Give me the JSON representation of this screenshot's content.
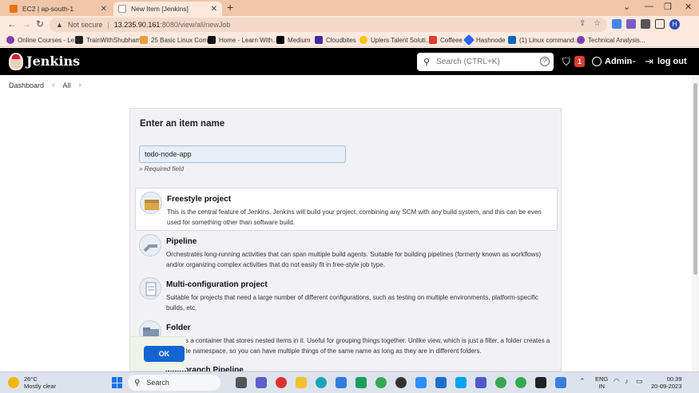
{
  "browser": {
    "tabs": [
      {
        "title": "EC2 | ap-south-1",
        "active": false,
        "icon": "aws-icon"
      },
      {
        "title": "New Item [Jenkins]",
        "active": true,
        "icon": "page-icon"
      }
    ],
    "address": {
      "security": "Not secure",
      "host": "13.235.90.161",
      "path": ":8080/view/all/newJob"
    },
    "profile_initial": "H",
    "bookmarks": [
      "Online Courses - Le...",
      "TrainWithShubham",
      "25 Basic Linux Com...",
      "Home - Learn With...",
      "Medium",
      "Cloudbites",
      "Uplers Talent Soluti...",
      "Coffeee",
      "Hashnode",
      "(1) Linux command...",
      "Technical Analysis..."
    ]
  },
  "header": {
    "app_name": "Jenkins",
    "search_placeholder": "Search (CTRL+K)",
    "notification_count": "1",
    "user": "Admin",
    "logout": "log out"
  },
  "breadcrumb": [
    "Dashboard",
    "All"
  ],
  "form": {
    "title": "Enter an item name",
    "item_name": "todo-node-app",
    "required_note": "» Required field",
    "ok_label": "OK"
  },
  "item_types": [
    {
      "name": "Freestyle project",
      "desc": "This is the central feature of Jenkins. Jenkins will build your project, combining any SCM with any build system, and this can be even used for something other than software build.",
      "selected": true,
      "icon": "freestyle-project-icon"
    },
    {
      "name": "Pipeline",
      "desc": "Orchestrates long-running activities that can span multiple build agents. Suitable for building pipelines (formerly known as workflows) and/or organizing complex activities that do not easily fit in free-style job type.",
      "selected": false,
      "icon": "pipeline-icon"
    },
    {
      "name": "Multi-configuration project",
      "desc": "Suitable for projects that need a large number of different configurations, such as testing on multiple environments, platform-specific builds, etc.",
      "selected": false,
      "icon": "multi-config-icon"
    },
    {
      "name": "Folder",
      "desc": "Creates a container that stores nested items in it. Useful for grouping things together. Unlike view, which is just a filter, a folder creates a separate namespace, so you can have multiple things of the same name as long as they are in different folders.",
      "selected": false,
      "icon": "folder-icon"
    }
  ],
  "partial_item": "Multibranch Pipeline",
  "taskbar": {
    "temperature": "26°C",
    "weather": "Mostly clear",
    "search": "Search",
    "lang": "ENG",
    "region": "IN",
    "time": "00:39",
    "date": "20-09-2023"
  }
}
